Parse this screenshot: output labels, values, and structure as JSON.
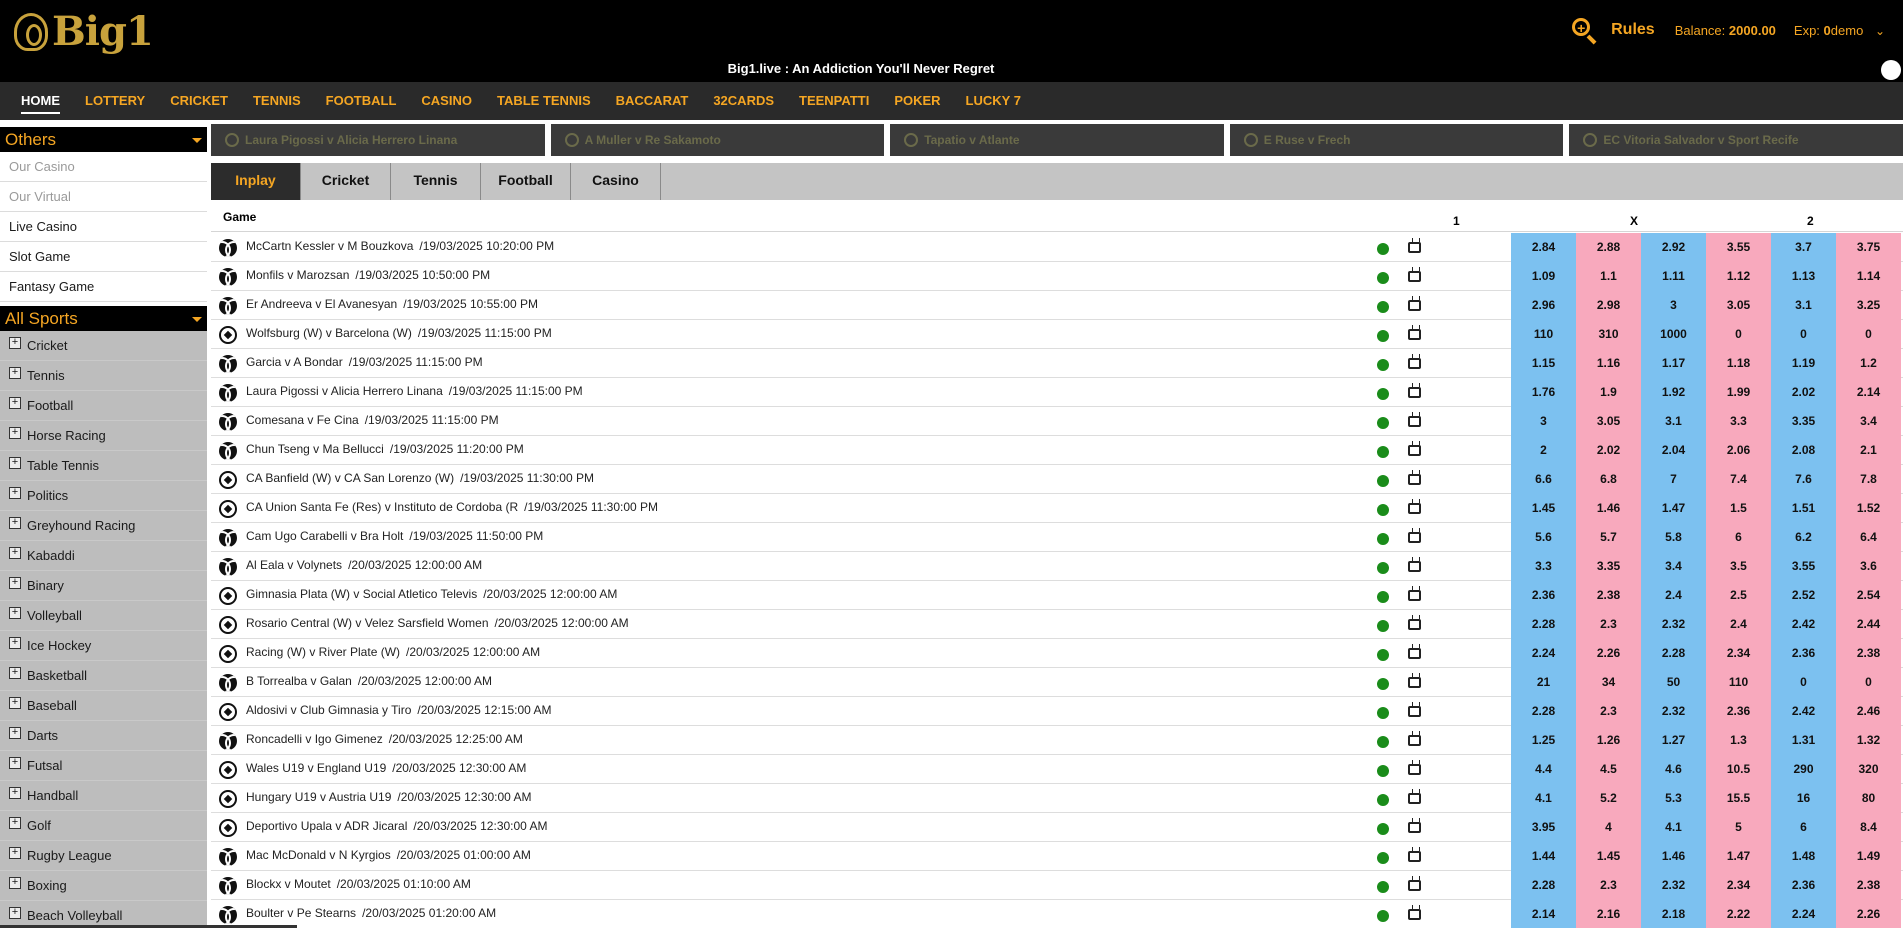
{
  "header": {
    "logo_text": "Big1",
    "tagline": "Big1.live : An Addiction You'll Never Regret",
    "rules_label": "Rules",
    "balance_label": "Balance:",
    "balance_value": "2000.00",
    "exp_label": "Exp:",
    "exp_value": "0",
    "username": "demo",
    "chevron": "⌄"
  },
  "nav": {
    "items": [
      "HOME",
      "LOTTERY",
      "CRICKET",
      "TENNIS",
      "FOOTBALL",
      "CASINO",
      "TABLE TENNIS",
      "BACCARAT",
      "32CARDS",
      "TEENPATTI",
      "POKER",
      "LUCKY 7"
    ]
  },
  "sidebar": {
    "others_title": "Others",
    "others": [
      {
        "label": "Our Casino",
        "dim": true
      },
      {
        "label": "Our Virtual",
        "dim": true
      },
      {
        "label": "Live Casino",
        "dim": false
      },
      {
        "label": "Slot Game",
        "dim": false
      },
      {
        "label": "Fantasy Game",
        "dim": false
      }
    ],
    "sports_title": "All Sports",
    "sports": [
      "Cricket",
      "Tennis",
      "Football",
      "Horse Racing",
      "Table Tennis",
      "Politics",
      "Greyhound Racing",
      "Kabaddi",
      "Binary",
      "Volleyball",
      "Ice Hockey",
      "Basketball",
      "Baseball",
      "Darts",
      "Futsal",
      "Handball",
      "Golf",
      "Rugby League",
      "Boxing",
      "Beach Volleyball"
    ]
  },
  "featured": [
    "Laura Pigossi v Alicia Herrero Linana",
    "A Muller v Re Sakamoto",
    "Tapatio v Atlante",
    "E Ruse v Frech",
    "EC Vitoria Salvador v Sport Recife"
  ],
  "tabs": [
    "Inplay",
    "Cricket",
    "Tennis",
    "Football",
    "Casino"
  ],
  "table": {
    "game_header": "Game",
    "col_1": "1",
    "col_x": "X",
    "col_2": "2",
    "rows": [
      {
        "sport": "tennis",
        "name": "McCartn Kessler v M Bouzkova",
        "date": "/19/03/2025 10:20:00 PM",
        "odds": [
          "2.84",
          "2.88",
          "2.92",
          "3.55",
          "3.7",
          "3.75"
        ]
      },
      {
        "sport": "tennis",
        "name": "Monfils v Marozsan",
        "date": "/19/03/2025 10:50:00 PM",
        "odds": [
          "1.09",
          "1.1",
          "1.11",
          "1.12",
          "1.13",
          "1.14"
        ]
      },
      {
        "sport": "tennis",
        "name": "Er Andreeva v El Avanesyan",
        "date": "/19/03/2025 10:55:00 PM",
        "odds": [
          "2.96",
          "2.98",
          "3",
          "3.05",
          "3.1",
          "3.25"
        ]
      },
      {
        "sport": "soccer",
        "name": "Wolfsburg (W) v Barcelona (W)",
        "date": "/19/03/2025 11:15:00 PM",
        "odds": [
          "110",
          "310",
          "1000",
          "0",
          "0",
          "0"
        ]
      },
      {
        "sport": "tennis",
        "name": "Garcia v A Bondar",
        "date": "/19/03/2025 11:15:00 PM",
        "odds": [
          "1.15",
          "1.16",
          "1.17",
          "1.18",
          "1.19",
          "1.2"
        ]
      },
      {
        "sport": "tennis",
        "name": "Laura Pigossi v Alicia Herrero Linana",
        "date": "/19/03/2025 11:15:00 PM",
        "odds": [
          "1.76",
          "1.9",
          "1.92",
          "1.99",
          "2.02",
          "2.14"
        ]
      },
      {
        "sport": "tennis",
        "name": "Comesana v Fe Cina",
        "date": "/19/03/2025 11:15:00 PM",
        "odds": [
          "3",
          "3.05",
          "3.1",
          "3.3",
          "3.35",
          "3.4"
        ]
      },
      {
        "sport": "tennis",
        "name": "Chun Tseng v Ma Bellucci",
        "date": "/19/03/2025 11:20:00 PM",
        "odds": [
          "2",
          "2.02",
          "2.04",
          "2.06",
          "2.08",
          "2.1"
        ]
      },
      {
        "sport": "soccer",
        "name": "CA Banfield (W) v CA San Lorenzo (W)",
        "date": "/19/03/2025 11:30:00 PM",
        "odds": [
          "6.6",
          "6.8",
          "7",
          "7.4",
          "7.6",
          "7.8"
        ]
      },
      {
        "sport": "soccer",
        "name": "CA Union Santa Fe (Res) v Instituto de Cordoba (R",
        "date": "/19/03/2025 11:30:00 PM",
        "odds": [
          "1.45",
          "1.46",
          "1.47",
          "1.5",
          "1.51",
          "1.52"
        ]
      },
      {
        "sport": "tennis",
        "name": "Cam Ugo Carabelli v Bra Holt",
        "date": "/19/03/2025 11:50:00 PM",
        "odds": [
          "5.6",
          "5.7",
          "5.8",
          "6",
          "6.2",
          "6.4"
        ]
      },
      {
        "sport": "tennis",
        "name": "Al Eala v Volynets",
        "date": "/20/03/2025 12:00:00 AM",
        "odds": [
          "3.3",
          "3.35",
          "3.4",
          "3.5",
          "3.55",
          "3.6"
        ]
      },
      {
        "sport": "soccer",
        "name": "Gimnasia Plata (W) v Social Atletico Televis",
        "date": "/20/03/2025 12:00:00 AM",
        "odds": [
          "2.36",
          "2.38",
          "2.4",
          "2.5",
          "2.52",
          "2.54"
        ]
      },
      {
        "sport": "soccer",
        "name": "Rosario Central (W) v Velez Sarsfield Women",
        "date": "/20/03/2025 12:00:00 AM",
        "odds": [
          "2.28",
          "2.3",
          "2.32",
          "2.4",
          "2.42",
          "2.44"
        ]
      },
      {
        "sport": "soccer",
        "name": "Racing (W) v River Plate (W)",
        "date": "/20/03/2025 12:00:00 AM",
        "odds": [
          "2.24",
          "2.26",
          "2.28",
          "2.34",
          "2.36",
          "2.38"
        ]
      },
      {
        "sport": "tennis",
        "name": "B Torrealba v Galan",
        "date": "/20/03/2025 12:00:00 AM",
        "odds": [
          "21",
          "34",
          "50",
          "110",
          "0",
          "0"
        ]
      },
      {
        "sport": "soccer",
        "name": "Aldosivi v Club Gimnasia y Tiro",
        "date": "/20/03/2025 12:15:00 AM",
        "odds": [
          "2.28",
          "2.3",
          "2.32",
          "2.36",
          "2.42",
          "2.46"
        ]
      },
      {
        "sport": "tennis",
        "name": "Roncadelli v Igo Gimenez",
        "date": "/20/03/2025 12:25:00 AM",
        "odds": [
          "1.25",
          "1.26",
          "1.27",
          "1.3",
          "1.31",
          "1.32"
        ]
      },
      {
        "sport": "soccer",
        "name": "Wales U19 v England U19",
        "date": "/20/03/2025 12:30:00 AM",
        "odds": [
          "4.4",
          "4.5",
          "4.6",
          "10.5",
          "290",
          "320"
        ]
      },
      {
        "sport": "soccer",
        "name": "Hungary U19 v Austria U19",
        "date": "/20/03/2025 12:30:00 AM",
        "odds": [
          "4.1",
          "5.2",
          "5.3",
          "15.5",
          "16",
          "80"
        ]
      },
      {
        "sport": "soccer",
        "name": "Deportivo Upala v ADR Jicaral",
        "date": "/20/03/2025 12:30:00 AM",
        "odds": [
          "3.95",
          "4",
          "4.1",
          "5",
          "6",
          "8.4"
        ]
      },
      {
        "sport": "tennis",
        "name": "Mac McDonald v N Kyrgios",
        "date": "/20/03/2025 01:00:00 AM",
        "odds": [
          "1.44",
          "1.45",
          "1.46",
          "1.47",
          "1.48",
          "1.49"
        ]
      },
      {
        "sport": "tennis",
        "name": "Blockx v Moutet",
        "date": "/20/03/2025 01:10:00 AM",
        "odds": [
          "2.28",
          "2.3",
          "2.32",
          "2.34",
          "2.36",
          "2.38"
        ]
      },
      {
        "sport": "tennis",
        "name": "Boulter v Pe Stearns",
        "date": "/20/03/2025 01:20:00 AM",
        "odds": [
          "2.14",
          "2.16",
          "2.18",
          "2.22",
          "2.24",
          "2.26"
        ]
      }
    ]
  },
  "colors": {
    "accent": "#f5a623",
    "back": "#7cc1f0",
    "lay": "#f8a9bd",
    "live": "#1a8c1a"
  }
}
